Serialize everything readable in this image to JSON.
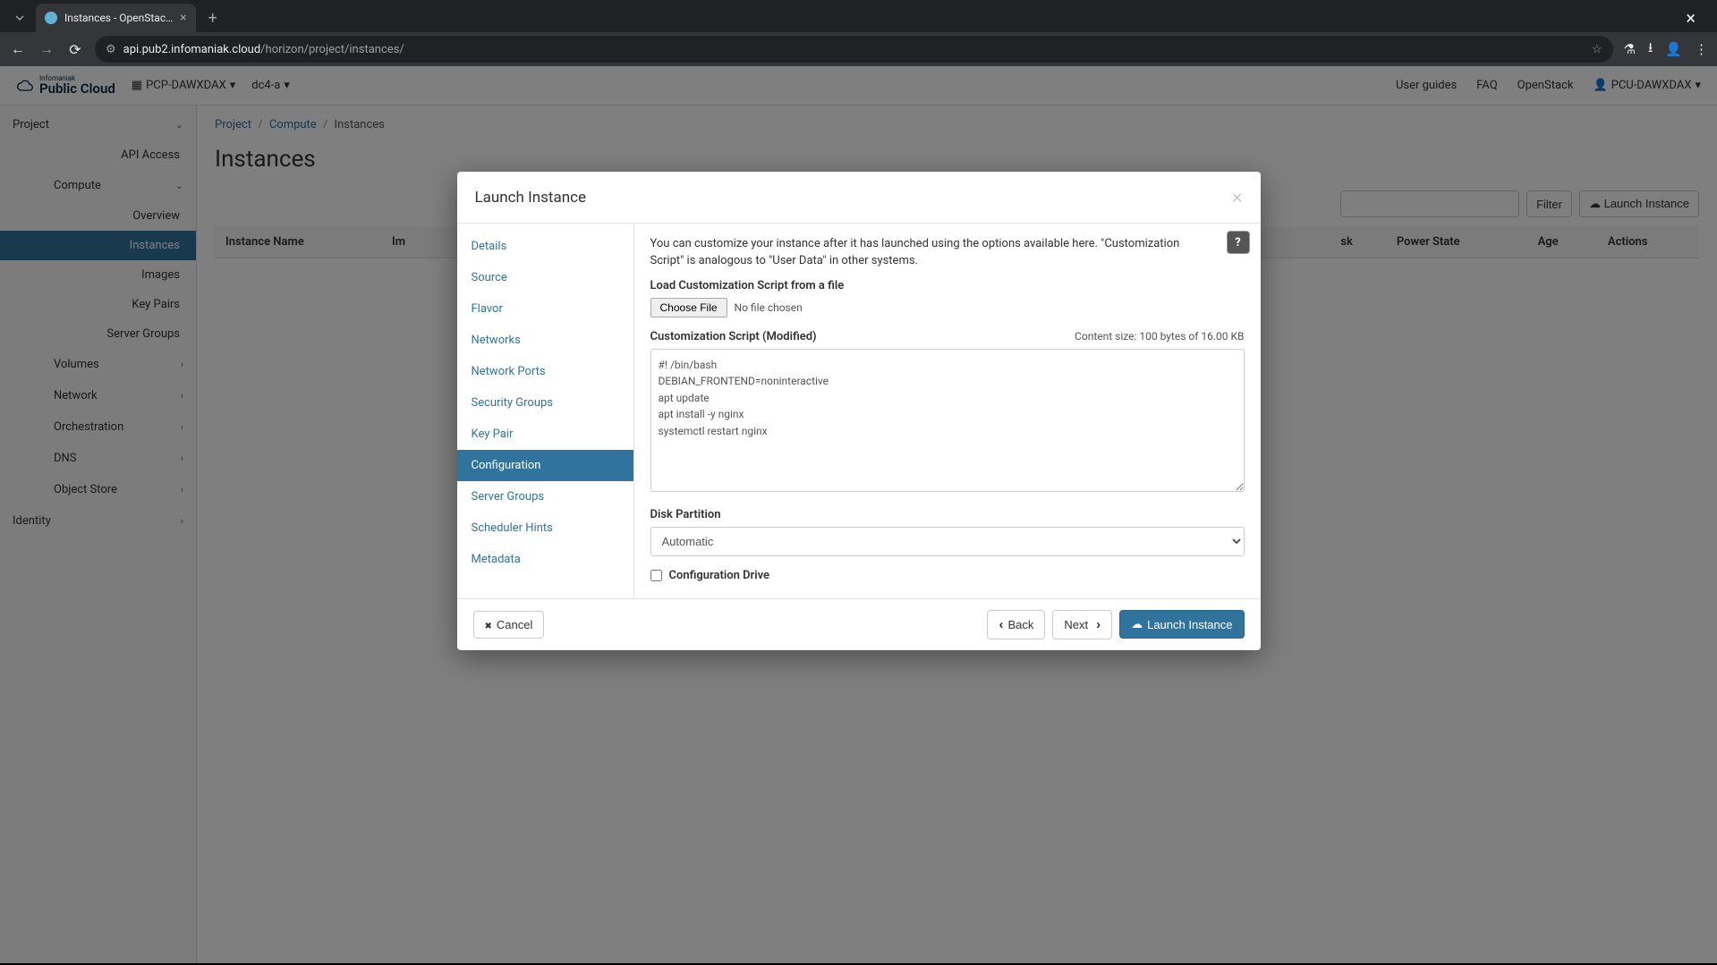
{
  "browser": {
    "tab_title": "Instances - OpenStac…",
    "url_host": "api.pub2.infomaniak.cloud",
    "url_path": "/horizon/project/instances/"
  },
  "top_nav": {
    "brand_sup": "Infomaniak",
    "brand": "Public Cloud",
    "project_switcher": "PCP-DAWXDAX",
    "region_switcher": "dc4-a",
    "links": {
      "user_guides": "User guides",
      "faq": "FAQ",
      "openstack": "OpenStack"
    },
    "user": "PCU-DAWXDAX"
  },
  "sidebar": {
    "project": "Project",
    "api_access": "API Access",
    "compute": "Compute",
    "overview": "Overview",
    "instances": "Instances",
    "images": "Images",
    "key_pairs": "Key Pairs",
    "server_groups": "Server Groups",
    "volumes": "Volumes",
    "network": "Network",
    "orchestration": "Orchestration",
    "dns": "DNS",
    "object_store": "Object Store",
    "identity": "Identity"
  },
  "main": {
    "breadcrumb": {
      "project": "Project",
      "compute": "Compute",
      "instances": "Instances"
    },
    "heading": "Instances",
    "filter_btn": "Filter",
    "launch_btn": "Launch Instance",
    "table_headers": {
      "instance_name": "Instance Name",
      "image": "Im",
      "task": "sk",
      "power_state": "Power State",
      "age": "Age",
      "actions": "Actions"
    }
  },
  "modal": {
    "title": "Launch Instance",
    "steps": {
      "details": "Details",
      "source": "Source",
      "flavor": "Flavor",
      "networks": "Networks",
      "network_ports": "Network Ports",
      "security_groups": "Security Groups",
      "key_pair": "Key Pair",
      "configuration": "Configuration",
      "server_groups": "Server Groups",
      "scheduler_hints": "Scheduler Hints",
      "metadata": "Metadata"
    },
    "description": "You can customize your instance after it has launched using the options available here. \"Customization Script\" is analogous to \"User Data\" in other systems.",
    "load_script_label": "Load Customization Script from a file",
    "choose_file_btn": "Choose File",
    "no_file": "No file chosen",
    "script_label": "Customization Script (Modified)",
    "content_size": "Content size: 100 bytes of 16.00 KB",
    "script_value": "#! /bin/bash\nDEBIAN_FRONTEND=noninteractive\napt update\napt install -y nginx\nsystemctl restart nginx",
    "disk_partition_label": "Disk Partition",
    "disk_partition_value": "Automatic",
    "config_drive_label": "Configuration Drive",
    "footer": {
      "cancel": "Cancel",
      "back": "Back",
      "next": "Next",
      "launch": "Launch Instance"
    }
  }
}
